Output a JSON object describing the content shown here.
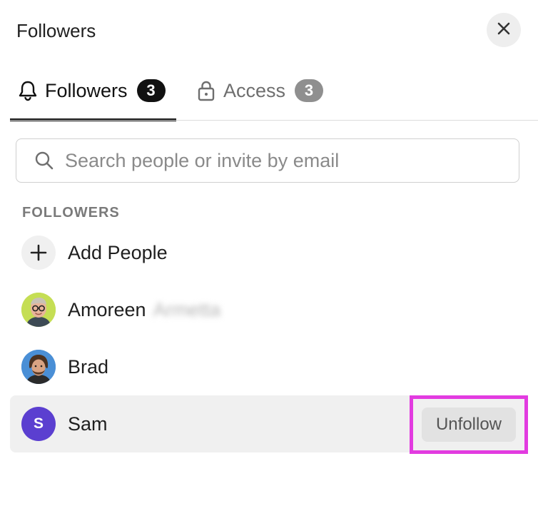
{
  "header": {
    "title": "Followers"
  },
  "tabs": [
    {
      "label": "Followers",
      "count": "3",
      "icon": "bell-icon",
      "active": true
    },
    {
      "label": "Access",
      "count": "3",
      "icon": "lock-icon",
      "active": false
    }
  ],
  "search": {
    "placeholder": "Search people or invite by email",
    "value": ""
  },
  "followers": {
    "section_label": "FOLLOWERS",
    "add_label": "Add People",
    "people": [
      {
        "name": "Amoreen",
        "surname_obscured": "Armetta",
        "avatar": "photo"
      },
      {
        "name": "Brad",
        "avatar": "photo"
      },
      {
        "name": "Sam",
        "avatar_letter": "S",
        "avatar": "initial"
      }
    ],
    "unfollow_label": "Unfollow"
  },
  "colors": {
    "accent_avatar": "#5b3fd0",
    "highlight_border": "#e23be0",
    "active_tab": "#111111"
  }
}
